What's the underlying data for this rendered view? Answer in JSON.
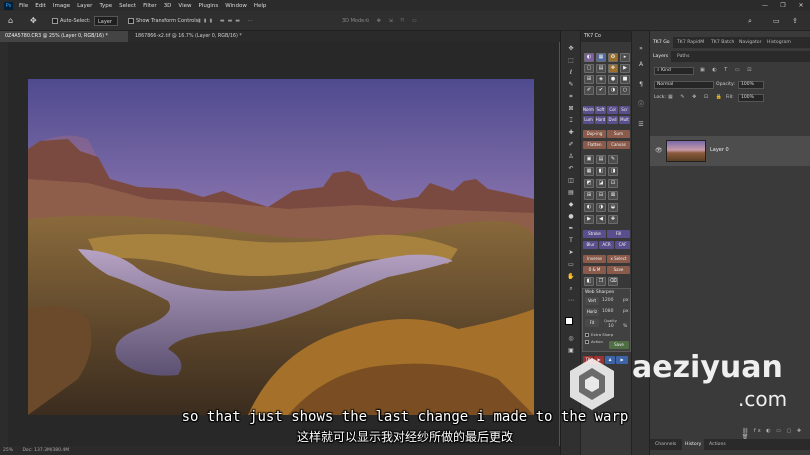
{
  "app": {
    "logo": "Ps"
  },
  "menu": [
    "File",
    "Edit",
    "Image",
    "Layer",
    "Type",
    "Select",
    "Filter",
    "3D",
    "View",
    "Plugins",
    "Window",
    "Help"
  ],
  "window_controls": [
    "—",
    "❐",
    "✕"
  ],
  "options_bar": {
    "auto_select_label": "Auto-Select:",
    "auto_select_value": "Layer",
    "transform_label": "Show Transform Controls",
    "mode_3d": "3D Mode:"
  },
  "doc_tabs": [
    {
      "label": "0Z4A5780.CR3 @ 25% (Layer 0, RGB/16) *",
      "active": true
    },
    {
      "label": "1867866-x2.tif @ 16.7% (Layer 0, RGB/16) *",
      "active": false
    }
  ],
  "status_bar": {
    "zoom": "25%",
    "doc_info": "Doc: 137.3M/380.4M"
  },
  "tk_panel": {
    "title": "TK7 Co",
    "rows": [
      [
        "Norm",
        "Soft",
        "Col",
        "Scr"
      ],
      [
        "Lum",
        "Hard",
        "Dvd",
        "Mult"
      ],
      [
        "Dup-ing",
        "Sum"
      ],
      [
        "Flatten",
        "Canvas"
      ],
      [
        "Stroke",
        "Fill"
      ],
      [
        "Blur",
        "ACR",
        "CAF"
      ],
      [
        "Inverse",
        "x Select"
      ],
      [
        "0 & M",
        "Save"
      ]
    ],
    "web_sharpen": {
      "title": "Web Sharpen",
      "vert_label": "Vert",
      "vert_value": "1200",
      "vert_unit": "px",
      "horiz_label": "Horiz",
      "horiz_value": "1080",
      "horiz_unit": "px",
      "fit_label": "Fit",
      "quality_label": "Quality",
      "quality_value": "10",
      "quality_unit": "%",
      "extra_sharp": "Extra Sharp",
      "action_label": "Action",
      "save_label": "Save"
    },
    "footer": "TK"
  },
  "right_panel": {
    "top_tabs": [
      "TK7 Go",
      "TK7 RapidM",
      "TK7 Batch",
      "Navigator",
      "Histogram"
    ],
    "layer_tabs": [
      "Layers",
      "Paths"
    ],
    "kind_label": "Kind",
    "blend_mode": "Normal",
    "opacity_label": "Opacity:",
    "opacity_value": "100%",
    "lock_label": "Lock:",
    "fill_label": "Fill:",
    "fill_value": "100%",
    "layer_name": "Layer 0",
    "bottom_tabs": [
      "Channels",
      "History",
      "Actions"
    ]
  },
  "watermark": {
    "brand": "aeziyuan",
    "tld": ".com"
  },
  "subtitles": {
    "en": "so that just shows the last change i made to the warp",
    "zh": "这样就可以显示我对经纱所做的最后更改"
  }
}
